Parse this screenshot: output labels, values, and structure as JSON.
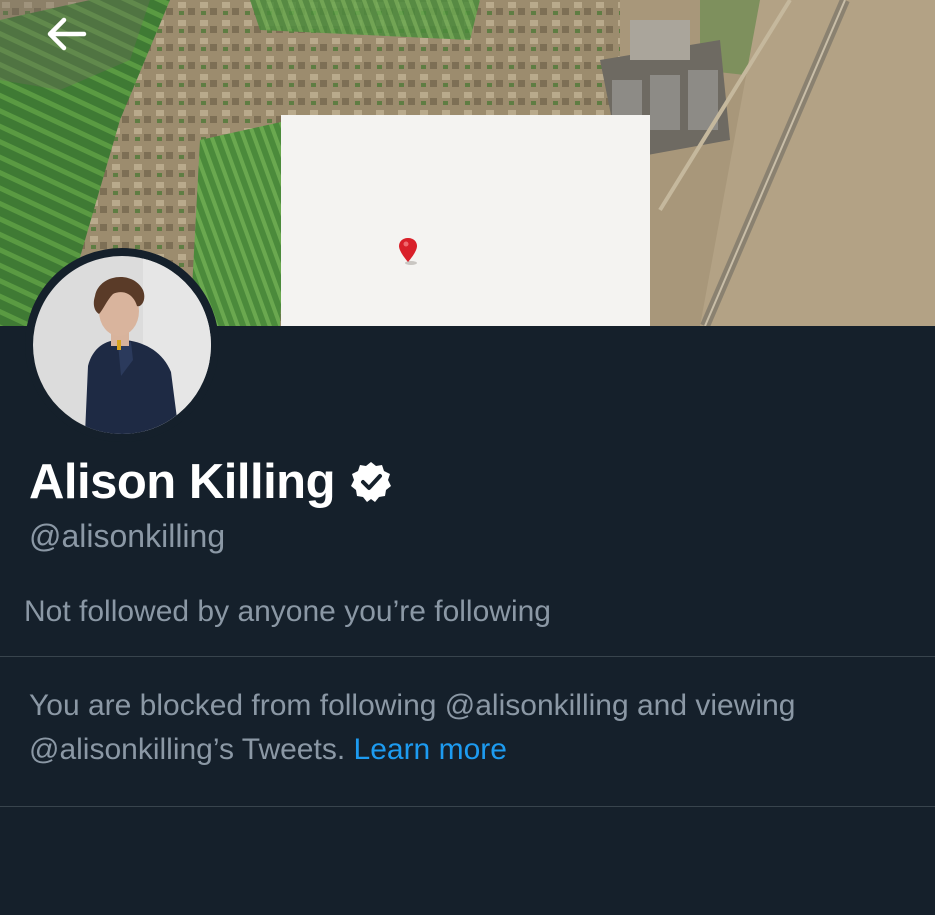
{
  "header": {
    "back_icon": "arrow-left-icon"
  },
  "profile": {
    "display_name": "Alison Killing",
    "verified_icon": "verified-badge-icon",
    "handle": "@alisonkilling",
    "followers_you_know": "Not followed by anyone you’re following"
  },
  "blocked_notice": {
    "line1": "You are blocked from following @alisonkilling and viewing",
    "line2": "@alisonkilling’s Tweets.",
    "link": "Learn more"
  },
  "colors": {
    "background": "#15202b",
    "primary_text": "#ffffff",
    "secondary_text": "#8b98a5",
    "accent": "#1d9bf0",
    "divider": "#38444d"
  }
}
